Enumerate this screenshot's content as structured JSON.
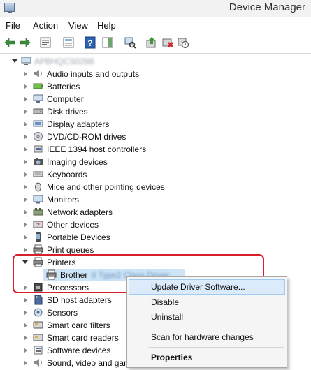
{
  "window": {
    "title": "Device Manager"
  },
  "menu": [
    "File",
    "Action",
    "View",
    "Help"
  ],
  "toolbar": [
    {
      "icon": "back-arrow-icon"
    },
    {
      "icon": "forward-arrow-icon"
    },
    {
      "icon": "properties-sheet-icon"
    },
    {
      "icon": "list-view-icon"
    },
    {
      "icon": "help-icon"
    },
    {
      "icon": "action-pane-icon"
    },
    {
      "icon": "scan-hardware-icon"
    },
    {
      "icon": "update-driver-icon"
    },
    {
      "icon": "uninstall-device-icon"
    },
    {
      "icon": "disable-device-icon"
    }
  ],
  "tree": {
    "root": "APBHQCS0288",
    "categories": [
      {
        "label": "Audio inputs and outputs",
        "icon": "speaker-icon"
      },
      {
        "label": "Batteries",
        "icon": "battery-icon"
      },
      {
        "label": "Computer",
        "icon": "computer-icon"
      },
      {
        "label": "Disk drives",
        "icon": "disk-drive-icon"
      },
      {
        "label": "Display adapters",
        "icon": "display-adapter-icon"
      },
      {
        "label": "DVD/CD-ROM drives",
        "icon": "dvd-drive-icon"
      },
      {
        "label": "IEEE 1394 host controllers",
        "icon": "ieee1394-icon"
      },
      {
        "label": "Imaging devices",
        "icon": "camera-icon"
      },
      {
        "label": "Keyboards",
        "icon": "keyboard-icon"
      },
      {
        "label": "Mice and other pointing devices",
        "icon": "mouse-icon"
      },
      {
        "label": "Monitors",
        "icon": "monitor-icon"
      },
      {
        "label": "Network adapters",
        "icon": "network-adapter-icon"
      },
      {
        "label": "Other devices",
        "icon": "unknown-device-icon"
      },
      {
        "label": "Portable Devices",
        "icon": "portable-device-icon"
      },
      {
        "label": "Print queues",
        "icon": "print-queue-icon"
      },
      {
        "label": "Printers",
        "icon": "printer-icon",
        "expanded": true
      },
      {
        "label": "Processors",
        "icon": "processor-icon"
      },
      {
        "label": "SD host adapters",
        "icon": "sd-card-icon"
      },
      {
        "label": "Sensors",
        "icon": "sensor-icon"
      },
      {
        "label": "Smart card filters",
        "icon": "smart-card-icon"
      },
      {
        "label": "Smart card readers",
        "icon": "smart-card-reader-icon"
      },
      {
        "label": "Software devices",
        "icon": "software-device-icon"
      },
      {
        "label": "Sound, video and gan",
        "icon": "sound-icon"
      }
    ],
    "printer_child": {
      "label": "Brother",
      "label_rest": "II Type2 Class Driver",
      "icon": "printer-icon"
    }
  },
  "context_menu": [
    {
      "label": "Update Driver Software...",
      "selected": true
    },
    {
      "label": "Disable"
    },
    {
      "label": "Uninstall"
    },
    {
      "label": "Scan for hardware changes"
    },
    {
      "label": "Properties",
      "bold": true
    }
  ],
  "colors": {
    "highlight_border": "#d8202c",
    "selection": "#cde4f7",
    "menu_hover": "#dcebfb"
  }
}
